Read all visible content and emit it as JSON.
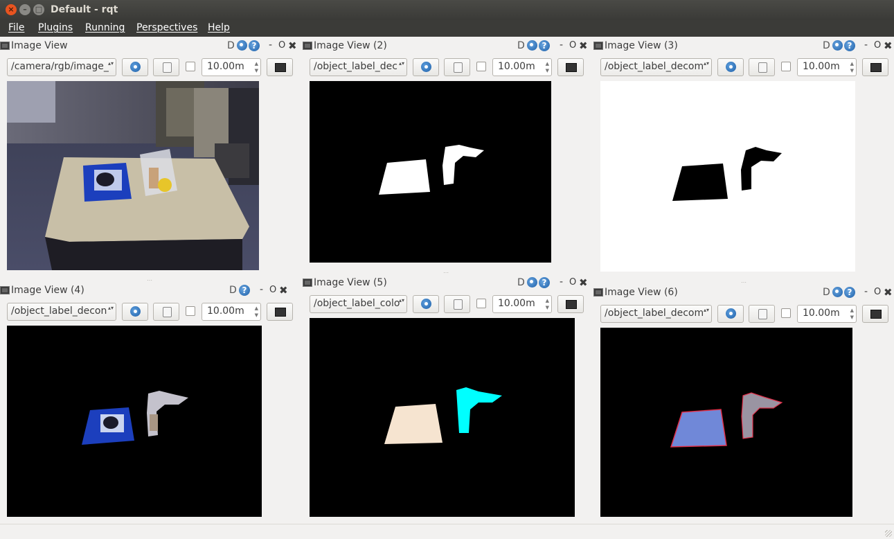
{
  "window": {
    "title": "Default - rqt",
    "close_glyph": "×",
    "min_glyph": "–",
    "max_glyph": "□"
  },
  "menu": {
    "items": [
      "File",
      "Plugins",
      "Running",
      "Perspectives",
      "Help"
    ]
  },
  "dock_tools": {
    "d_label": "D",
    "help_label": "?",
    "min_label": "-",
    "float_label": "O",
    "close_label": "✖"
  },
  "spin_arrows": {
    "up": "▲",
    "down": "▼"
  },
  "combo_arrows": "▴▾",
  "panels": [
    {
      "title": "Image View",
      "topic": "/camera/rgb/image_",
      "timeout": "10.00m",
      "view": "camera"
    },
    {
      "title": "Image View (2)",
      "topic": "/object_label_dec",
      "timeout": "10.00m",
      "view": "mask-white"
    },
    {
      "title": "Image View (3)",
      "topic": "/object_label_decom",
      "timeout": "10.00m",
      "view": "mask-inverted"
    },
    {
      "title": "Image View (4)",
      "topic": "/object_label_decon",
      "timeout": "10.00m",
      "view": "masked-rgb"
    },
    {
      "title": "Image View (5)",
      "topic": "/object_label_colo",
      "timeout": "10.00m",
      "view": "label-color"
    },
    {
      "title": "Image View (6)",
      "topic": "/object_label_decom",
      "timeout": "10.00m",
      "view": "overlay"
    }
  ],
  "colors": {
    "titlebar": "#3c3b37",
    "menubar": "#3b3b38",
    "close_button": "#e95420",
    "label_cream": "#f6e4d0",
    "label_cyan": "#00ffff",
    "overlay_blue": "#7088d8",
    "overlay_gray": "#9a94a2",
    "overlay_red": "#e0304a"
  }
}
